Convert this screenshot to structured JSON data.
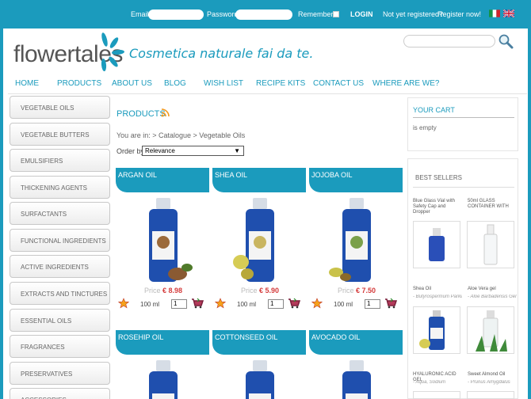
{
  "topbar": {
    "email_label": "Email",
    "password_label": "Password",
    "remember_label": "Remember",
    "login_label": "LOGIN",
    "not_registered": "Not yet registered?",
    "register_label": "Register now!"
  },
  "header": {
    "logo": "flowertales",
    "tagline": "Cosmetica naturale fai da te."
  },
  "nav": {
    "items": [
      "HOME",
      "PRODUCTS",
      "ABOUT US",
      "BLOG",
      "WISH LIST",
      "RECIPE KITS",
      "CONTACT US",
      "WHERE ARE WE?"
    ]
  },
  "sidebar": {
    "categories": [
      "VEGETABLE OILS",
      "VEGETABLE BUTTERS",
      "EMULSIFIERS",
      "THICKENING AGENTS",
      "SURFACTANTS",
      "FUNCTIONAL INGREDIENTS",
      "ACTIVE INGREDIENTS",
      "EXTRACTS AND TINCTURES",
      "ESSENTIAL OILS",
      "FRAGRANCES",
      "PRESERVATIVES",
      "ACCESSORIES"
    ]
  },
  "main": {
    "title": "PRODUCTS",
    "breadcrumb": "You are in:  > Catalogue  > Vegetable Oils",
    "orderby_label": "Order by",
    "orderby_value": "Relevance",
    "price_label": "Price",
    "products": [
      {
        "name": "ARGAN OIL",
        "price": "€ 8.98",
        "size": "100 ml",
        "qty": "1"
      },
      {
        "name": "SHEA OIL",
        "price": "€ 5.90",
        "size": "100 ml",
        "qty": "1"
      },
      {
        "name": "JOJOBA OIL",
        "price": "€ 7.50",
        "size": "100 ml",
        "qty": "1"
      },
      {
        "name": "ROSEHIP OIL"
      },
      {
        "name": "COTTONSEED OIL"
      },
      {
        "name": "AVOCADO OIL"
      }
    ]
  },
  "cart": {
    "title": "YOUR CART",
    "status": "is empty"
  },
  "bestsellers": {
    "title": "BEST SELLERS",
    "items": [
      {
        "name": "Blue Glass Vial with Safety Cap and Dropper"
      },
      {
        "name": "50ml GLASS CONTAINER WITH"
      },
      {
        "name": "Shea Oil",
        "sub": "- Butyrospermum Parkii"
      },
      {
        "name": "Aloe Vera gel",
        "sub": "- Aloe Barbadensis Gel"
      },
      {
        "name": "HYALURONIC ACID GEL",
        "sub": "- Aqua, Sodium"
      },
      {
        "name": "Sweet Almond Oil",
        "sub": "- Prunus Amygdalus"
      }
    ]
  },
  "colors": {
    "accent": "#1b9bbd",
    "price": "#d43b3b"
  }
}
